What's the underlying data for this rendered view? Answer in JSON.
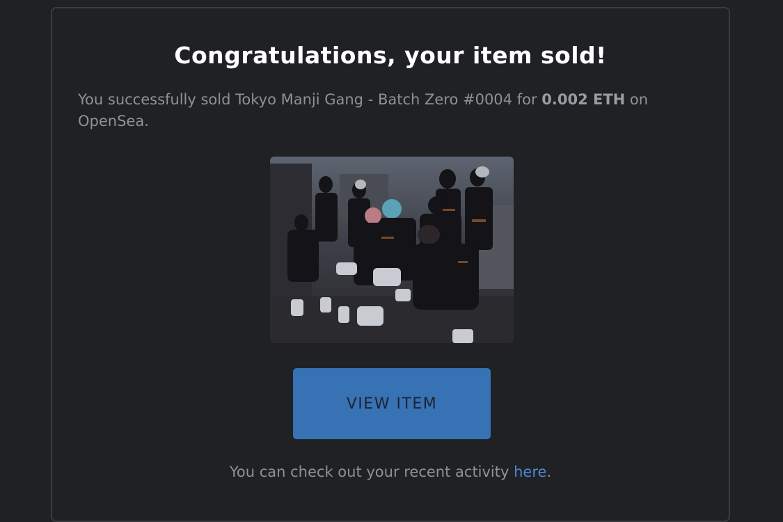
{
  "email": {
    "title": "Congratulations, your item sold!",
    "message_prefix": "You successfully sold Tokyo Manji Gang - Batch Zero #0004 for ",
    "amount": "0.002 ETH",
    "message_suffix": " on OpenSea.",
    "button_label": "VIEW ITEM",
    "footer_prefix": "You can check out your recent activity ",
    "footer_link": "here",
    "footer_suffix": ".",
    "colors": {
      "background": "#202124",
      "button": "#3772b5",
      "link": "#4b88d6",
      "title": "#ffffff",
      "body_text": "#8f9196"
    },
    "image_icon": "nft-item-image"
  }
}
